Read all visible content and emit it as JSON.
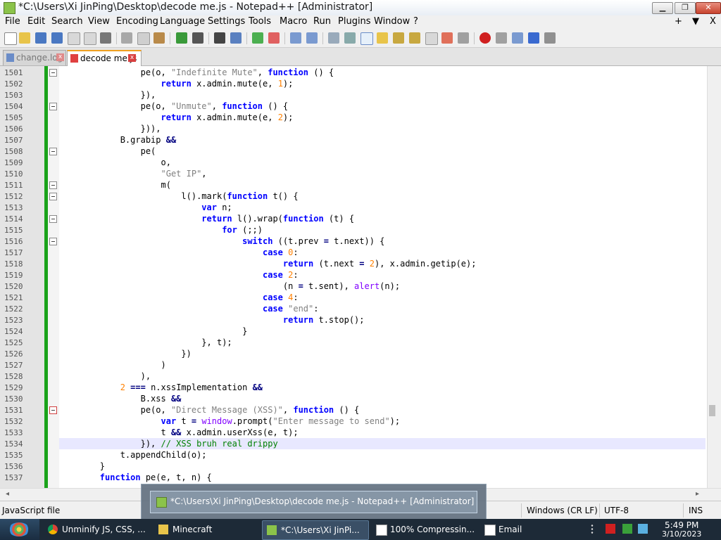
{
  "window": {
    "title": "*C:\\Users\\Xi JinPing\\Desktop\\decode me.js - Notepad++ [Administrator]",
    "minimize_glyph": "▁",
    "maximize_glyph": "❐",
    "close_glyph": "✕"
  },
  "menu": {
    "items": [
      "File",
      "Edit",
      "Search",
      "View",
      "Encoding",
      "Language",
      "Settings",
      "Tools",
      "Macro",
      "Run",
      "Plugins",
      "Window",
      "?"
    ],
    "right_plus": "+",
    "right_arrow": "▼",
    "right_close": "X"
  },
  "tabs": [
    {
      "label": "change.log",
      "active": false
    },
    {
      "label": "decode me.js",
      "active": true
    }
  ],
  "editor": {
    "language": "JavaScript",
    "current_line": 1534,
    "line_numbers": [
      "1501",
      "1502",
      "1503",
      "1504",
      "1505",
      "1506",
      "1507",
      "1508",
      "1509",
      "1510",
      "1511",
      "1512",
      "1513",
      "1514",
      "1515",
      "1516",
      "1517",
      "1518",
      "1519",
      "1520",
      "1521",
      "1522",
      "1523",
      "1524",
      "1525",
      "1526",
      "1527",
      "1528",
      "1529",
      "1530",
      "1531",
      "1532",
      "1533",
      "1534",
      "1535",
      "1536",
      "1537"
    ],
    "lines": [
      "                pe(o, \"Indefinite Mute\", function () {",
      "                    return x.admin.mute(e, 1);",
      "                }),",
      "                pe(o, \"Unmute\", function () {",
      "                    return x.admin.mute(e, 2);",
      "                })),",
      "            B.grabip &&",
      "                pe(",
      "                    o,",
      "                    \"Get IP\",",
      "                    m(",
      "                        l().mark(function t() {",
      "                            var n;",
      "                            return l().wrap(function (t) {",
      "                                for (;;)",
      "                                    switch ((t.prev = t.next)) {",
      "                                        case 0:",
      "                                            return (t.next = 2), x.admin.getip(e);",
      "                                        case 2:",
      "                                            (n = t.sent), alert(n);",
      "                                        case 4:",
      "                                        case \"end\":",
      "                                            return t.stop();",
      "                                    }",
      "                            }, t);",
      "                        })",
      "                    )",
      "                ),",
      "            2 === n.xssImplementation &&",
      "                B.xss &&",
      "                pe(o, \"Direct Message (XSS)\", function () {",
      "                    var t = window.prompt(\"Enter message to send\");",
      "                    t && x.admin.userXss(e, t);",
      "                }), // XSS bruh real drippy",
      "            t.appendChild(o);",
      "        }",
      "        function pe(e, t, n) {"
    ]
  },
  "status": {
    "file_type": "JavaScript file",
    "eol": "Windows (CR LF)",
    "encoding": "UTF-8",
    "mode": "INS"
  },
  "taskbar": {
    "preview_title": "*C:\\Users\\Xi JinPing\\Desktop\\decode me.js - Notepad++ [Administrator]",
    "items": [
      {
        "label": "Unminify JS, CSS, ..."
      },
      {
        "label": "Minecraft"
      },
      {
        "label": "*C:\\Users\\Xi JinPi..."
      },
      {
        "label": "100% Compressin..."
      },
      {
        "label": "Email"
      }
    ],
    "time": "5:49 PM",
    "date": "3/10/2023"
  },
  "colors": {
    "keyword": "#0000ff",
    "string": "#808080",
    "number": "#ff8000",
    "operator": "#000080",
    "comment": "#008000",
    "change_bar": "#1aa31a"
  }
}
